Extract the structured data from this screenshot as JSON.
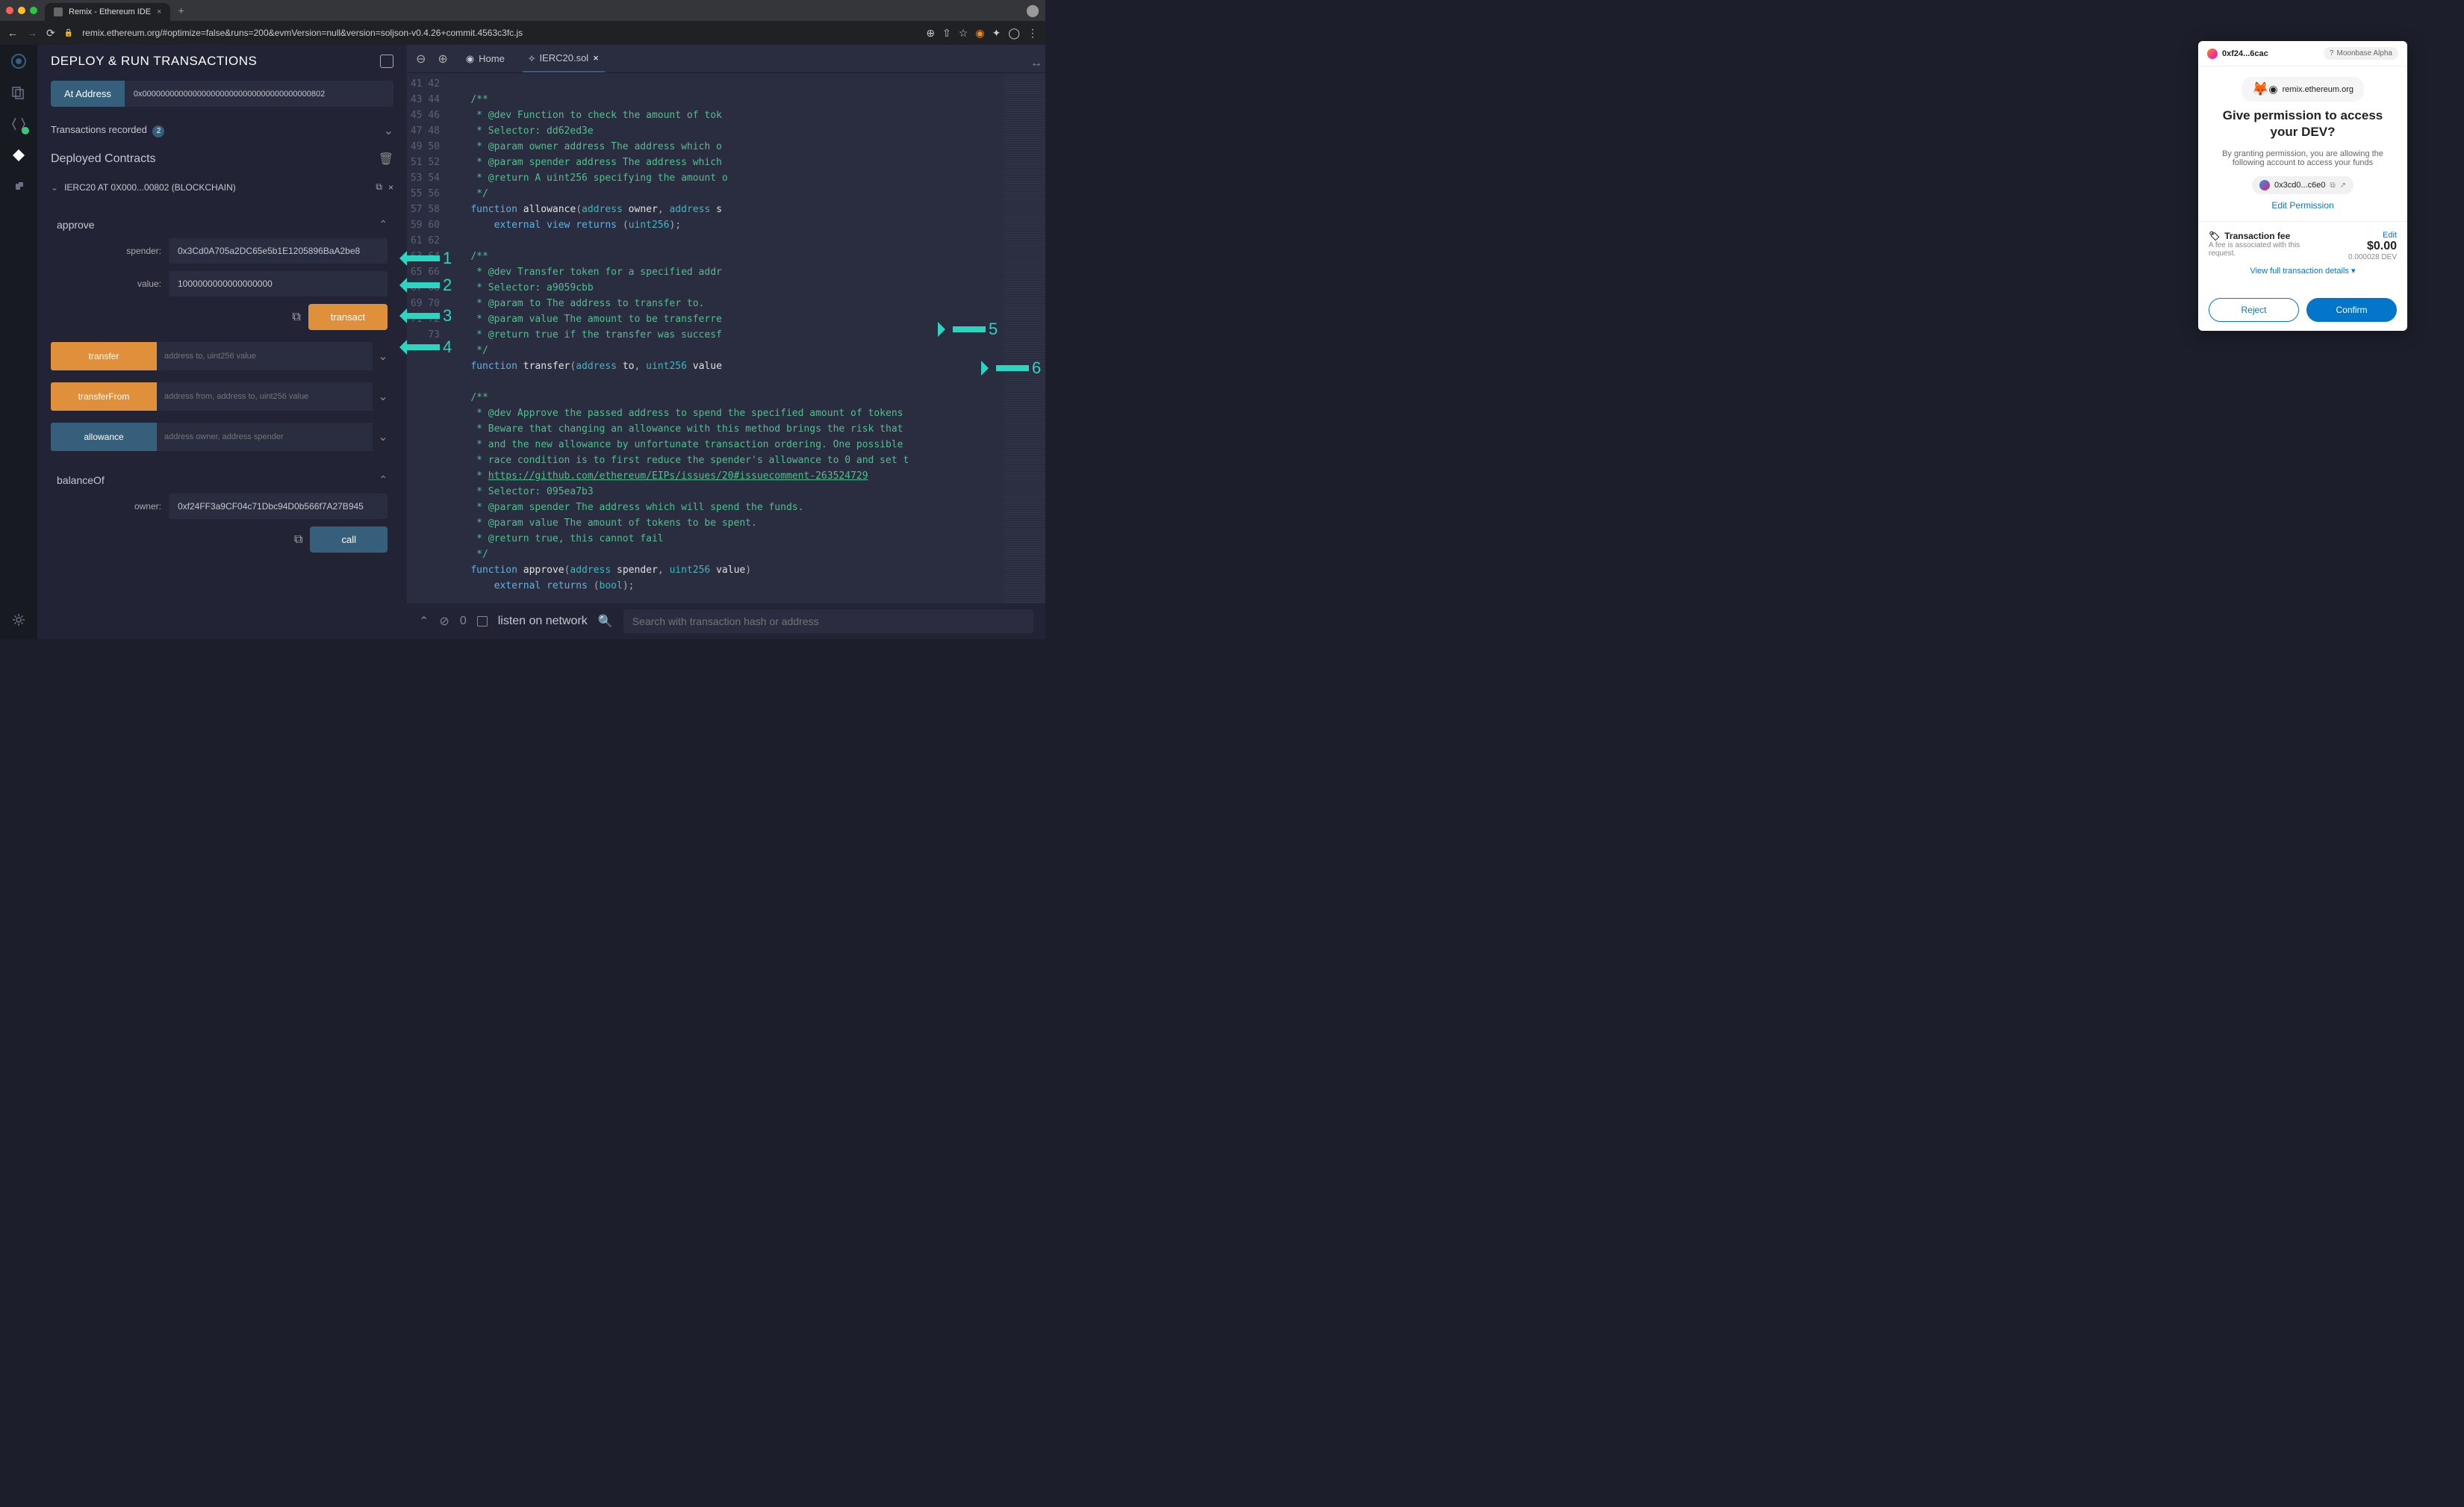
{
  "browser": {
    "tab_title": "Remix - Ethereum IDE",
    "url": "remix.ethereum.org/#optimize=false&runs=200&evmVersion=null&version=soljson-v0.4.26+commit.4563c3fc.js"
  },
  "panel": {
    "title": "DEPLOY & RUN TRANSACTIONS",
    "at_address_label": "At Address",
    "at_address_value": "0x0000000000000000000000000000000000000802",
    "tx_recorded_label": "Transactions recorded",
    "tx_recorded_count": "2",
    "deployed_label": "Deployed Contracts",
    "contract_name": "IERC20 AT 0X000...00802 (BLOCKCHAIN)"
  },
  "approve": {
    "name": "approve",
    "spender_label": "spender:",
    "spender_value": "0x3Cd0A705a2DC65e5b1E1205896BaA2be8",
    "value_label": "value:",
    "value_value": "1000000000000000000",
    "transact_label": "transact"
  },
  "transfer": {
    "name": "transfer",
    "placeholder": "address to, uint256 value"
  },
  "transferFrom": {
    "name": "transferFrom",
    "placeholder": "address from, address to, uint256 value"
  },
  "allowance": {
    "name": "allowance",
    "placeholder": "address owner, address spender"
  },
  "balanceOf": {
    "name": "balanceOf",
    "owner_label": "owner:",
    "owner_value": "0xf24FF3a9CF04c71Dbc94D0b566f7A27B945",
    "call_label": "call"
  },
  "editor": {
    "home_label": "Home",
    "file_label": "IERC20.sol",
    "lines_start": 41,
    "lines_end": 73
  },
  "terminal": {
    "count": "0",
    "listen_label": "listen on network",
    "search_placeholder": "Search with transaction hash or address"
  },
  "metamask": {
    "account": "0xf24...6cac",
    "network": "Moonbase Alpha",
    "site": "remix.ethereum.org",
    "permission_title": "Give permission to access your DEV?",
    "permission_desc": "By granting permission, you are allowing the following account to access your funds",
    "contract_addr": "0x3cd0...c6e0",
    "edit_permission": "Edit Permission",
    "fee_title": "Transaction fee",
    "fee_edit": "Edit",
    "fee_desc": "A fee is associated with this request.",
    "fee_amount": "$0.00",
    "fee_sub": "0.000028 DEV",
    "view_details": "View full transaction details",
    "reject": "Reject",
    "confirm": "Confirm"
  },
  "callouts": [
    "1",
    "2",
    "3",
    "4",
    "5",
    "6"
  ]
}
